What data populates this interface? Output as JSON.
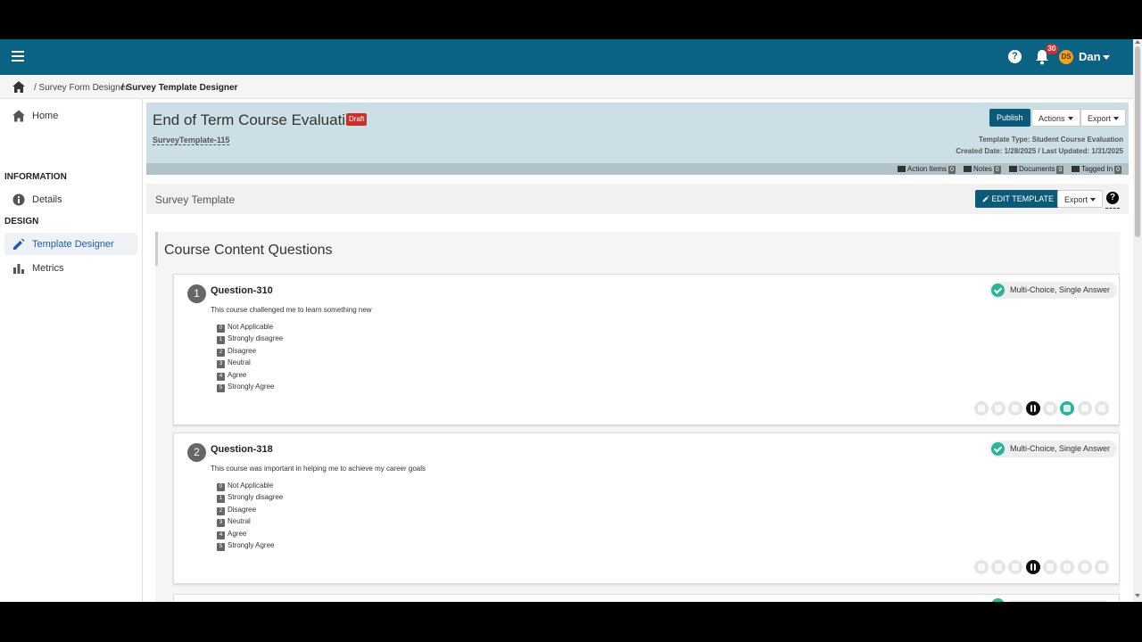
{
  "topbar": {
    "notifications": "30",
    "avatar_initials": "DS",
    "username": "Dan"
  },
  "breadcrumb": {
    "items": [
      "/ Survey Form Designer",
      "/ Survey Template Designer"
    ]
  },
  "sidebar": {
    "home": "Home",
    "section_information": "INFORMATION",
    "details": "Details",
    "section_design": "DESIGN",
    "template_designer": "Template Designer",
    "metrics": "Metrics"
  },
  "header": {
    "title": "End of Term Course Evaluation",
    "status": "Draft",
    "template_id": "SurveyTemplate-115",
    "publish": "Publish",
    "actions": "Actions",
    "export": "Export",
    "template_type": "Template Type: Student Course Evaluation",
    "dates": "Created Date: 1/28/2025 / Last Updated: 1/31/2025"
  },
  "tags": [
    {
      "label": "Action Items",
      "count": "0"
    },
    {
      "label": "Notes",
      "count": "0"
    },
    {
      "label": "Documents",
      "count": "0"
    },
    {
      "label": "Tagged In",
      "count": "0"
    }
  ],
  "survey": {
    "title": "Survey Template",
    "edit": "EDIT TEMPLATE",
    "export": "Export",
    "help": "?"
  },
  "section": {
    "title": "Course Content Questions"
  },
  "questions": [
    {
      "number": "1",
      "name": "Question-310",
      "text": "This course challenged me to learn something new",
      "type": "Multi-Choice, Single Answer",
      "options": [
        {
          "n": "0",
          "label": "Not Applicable"
        },
        {
          "n": "1",
          "label": "Strongly disagree"
        },
        {
          "n": "2",
          "label": "Disagree"
        },
        {
          "n": "3",
          "label": "Neutral"
        },
        {
          "n": "4",
          "label": "Agree"
        },
        {
          "n": "5",
          "label": "Strongly Agree"
        }
      ]
    },
    {
      "number": "2",
      "name": "Question-318",
      "text": "This course was important in helping me to achieve my career goals",
      "type": "Multi-Choice, Single Answer",
      "options": [
        {
          "n": "0",
          "label": "Not Applicable"
        },
        {
          "n": "1",
          "label": "Strongly disagree"
        },
        {
          "n": "2",
          "label": "Disagree"
        },
        {
          "n": "3",
          "label": "Neutral"
        },
        {
          "n": "4",
          "label": "Agree"
        },
        {
          "n": "5",
          "label": "Strongly Agree"
        }
      ]
    }
  ],
  "colors": {
    "topbar": "#0b6282",
    "accent": "#2bb39b",
    "draft": "#c9302c",
    "primary_button": "#0b5a7a"
  }
}
